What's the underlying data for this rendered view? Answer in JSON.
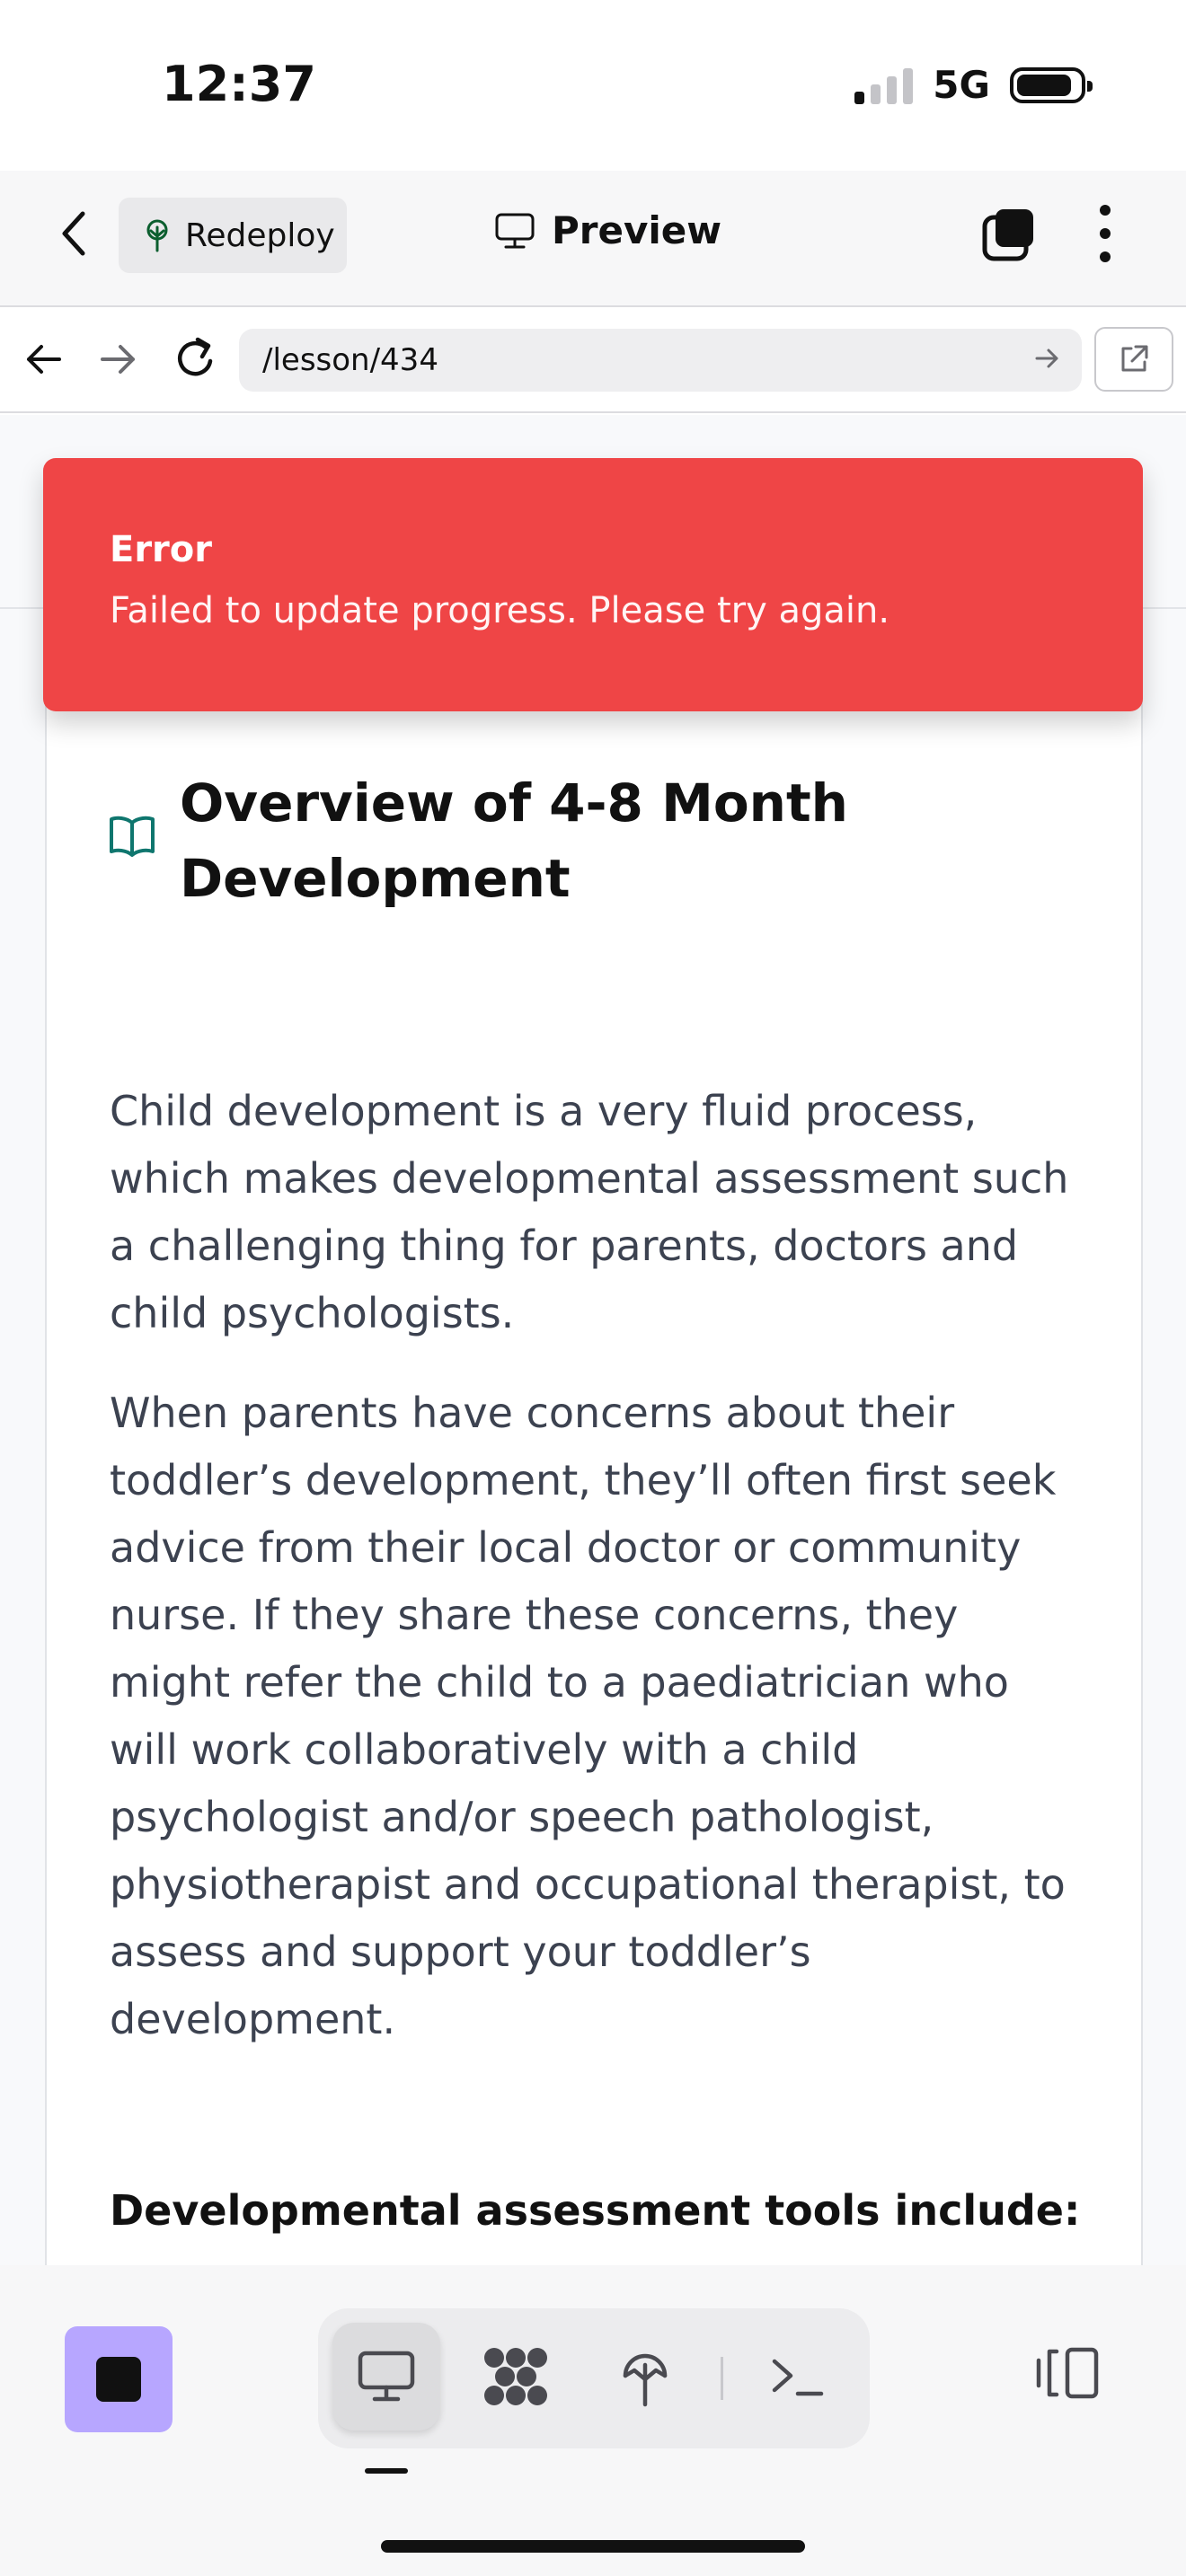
{
  "status_bar": {
    "time": "12:37",
    "network": "5G"
  },
  "app_bar": {
    "redeploy_label": "Redeploy",
    "preview_label": "Preview"
  },
  "browser": {
    "url": "/lesson/434"
  },
  "toast": {
    "title": "Error",
    "message": "Failed to update progress. Please try again."
  },
  "lesson": {
    "title": "Overview of 4-8 Month Development",
    "paragraphs": [
      "Child development is a very fluid process, which makes developmental assessment such a challenging thing for parents, doctors and child psychologists.",
      "When parents have concerns about their toddler’s development, they’ll often first seek advice from their local doctor or community nurse. If they share these concerns, they might refer the child to a paediatrician who will work collaboratively with a child psychologist and/or speech pathologist, physiotherapist and occupational therapist, to assess and support your toddler’s development."
    ],
    "subheading": "Developmental assessment tools include:"
  },
  "icons": {
    "back": "chevron-left-icon",
    "redeploy": "tree-icon",
    "preview": "monitor-icon",
    "tabs": "tabs-icon",
    "more": "more-vertical-icon",
    "nav_back": "arrow-left-icon",
    "nav_forward": "arrow-right-icon",
    "reload": "reload-icon",
    "go": "arrow-right-icon",
    "open_external": "external-link-icon",
    "lesson": "book-open-icon",
    "mode_preview": "monitor-icon",
    "mode_workflows": "workflows-icon",
    "mode_deploy": "tree-icon",
    "mode_terminal": "terminal-icon",
    "panel": "panel-icon"
  },
  "colors": {
    "error": "#ef4546",
    "accent_teal": "#0f766e",
    "stop_button": "#b7a6ff",
    "redeploy_icon": "#0b5e2e"
  }
}
